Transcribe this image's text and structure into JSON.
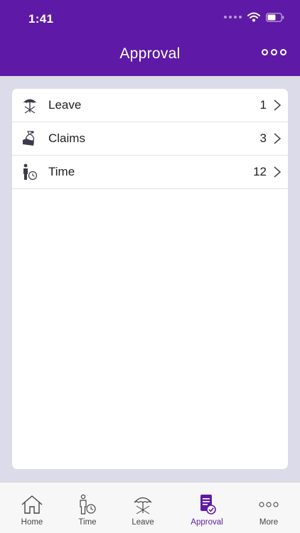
{
  "status_bar": {
    "time": "1:41"
  },
  "header": {
    "title": "Approval"
  },
  "items": [
    {
      "label": "Leave",
      "count": "1",
      "icon": "beach-umbrella-icon"
    },
    {
      "label": "Claims",
      "count": "3",
      "icon": "money-bag-icon"
    },
    {
      "label": "Time",
      "count": "12",
      "icon": "person-clock-icon"
    }
  ],
  "tabs": [
    {
      "label": "Home",
      "icon": "home-icon"
    },
    {
      "label": "Time",
      "icon": "person-clock-icon"
    },
    {
      "label": "Leave",
      "icon": "beach-umbrella-icon"
    },
    {
      "label": "Approval",
      "icon": "approval-document-icon",
      "active": true
    },
    {
      "label": "More",
      "icon": "more-dots-icon"
    }
  ],
  "colors": {
    "brand": "#5e1aa6",
    "background": "#dcdbe9",
    "icon": "#3d3a4c"
  }
}
